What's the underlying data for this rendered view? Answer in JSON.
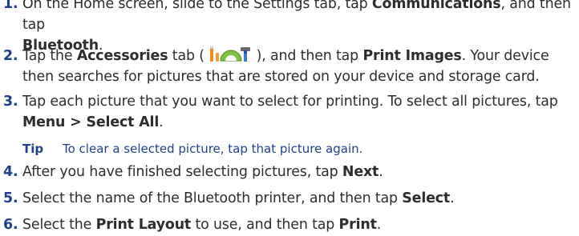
{
  "steps": [
    {
      "number": "1.",
      "parts": [
        {
          "text": "On the Home screen, slide to the Settings tab, tap "
        },
        {
          "text": "Communications",
          "bold": true
        },
        {
          "text": ", and then tap "
        },
        {
          "text": "Bluetooth",
          "bold": true
        },
        {
          "text": "."
        }
      ]
    },
    {
      "number": "2.",
      "parts": [
        {
          "text": "Tap the "
        },
        {
          "text": "Accessories",
          "bold": true
        },
        {
          "text": " tab ( "
        },
        {
          "icon": "accessories-tab-icon"
        },
        {
          "text": " ), and then tap "
        },
        {
          "text": "Print Images",
          "bold": true
        },
        {
          "text": ". Your device then searches for pictures that are stored on your device and storage card."
        }
      ]
    },
    {
      "number": "3.",
      "parts": [
        {
          "text": "Tap each picture that you want to select for printing. To select all pictures, tap "
        },
        {
          "text": "Menu > Select All",
          "bold": true
        },
        {
          "text": "."
        }
      ]
    },
    {
      "number": "4.",
      "parts": [
        {
          "text": "After you have finished selecting pictures, tap "
        },
        {
          "text": "Next",
          "bold": true
        },
        {
          "text": "."
        }
      ]
    },
    {
      "number": "5.",
      "parts": [
        {
          "text": "Select the name of the Bluetooth printer, and then tap "
        },
        {
          "text": "Select",
          "bold": true
        },
        {
          "text": "."
        }
      ]
    },
    {
      "number": "6.",
      "parts": [
        {
          "text": "Select the "
        },
        {
          "text": "Print Layout",
          "bold": true
        },
        {
          "text": " to use, and then tap "
        },
        {
          "text": "Print",
          "bold": true
        },
        {
          "text": "."
        }
      ]
    }
  ],
  "tip": {
    "label": "Tip",
    "text": "To clear a selected picture, tap that picture again."
  },
  "colors": {
    "accent": "#1f3f8f",
    "body_text": "#2d2d2d"
  }
}
